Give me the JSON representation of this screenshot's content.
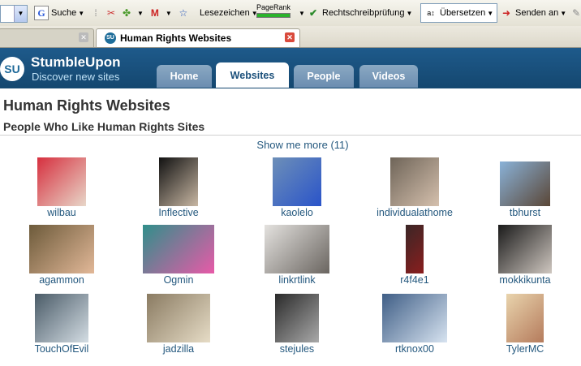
{
  "toolbar": {
    "search_label": "Suche",
    "bookmarks_label": "Lesezeichen",
    "pagerank_label": "PageRank",
    "spellcheck_label": "Rechtschreibprüfung",
    "translate_label": "Übersetzen",
    "send_label": "Senden an"
  },
  "browser_tabs": [
    {
      "label": "",
      "active": false
    },
    {
      "label": "Human Rights Websites",
      "active": true
    }
  ],
  "site": {
    "logo_mark": "SU",
    "name": "StumbleUpon",
    "tagline": "Discover new sites",
    "nav": [
      "Home",
      "Websites",
      "People",
      "Videos"
    ],
    "active_nav": "Websites"
  },
  "page": {
    "title": "Human Rights Websites",
    "subtitle": "People Who Like Human Rights Sites",
    "show_more": "Show me more (11)"
  },
  "people": [
    {
      "name": "wilbau",
      "colors": [
        "#d62f3e",
        "#e8d7c9"
      ]
    },
    {
      "name": "Inflective",
      "colors": [
        "#111111",
        "#c8b7a3"
      ]
    },
    {
      "name": "kaolelo",
      "colors": [
        "#6d8fb8",
        "#2a54c9"
      ]
    },
    {
      "name": "individualathome",
      "colors": [
        "#6e6458",
        "#d5c0ad"
      ]
    },
    {
      "name": "tbhurst",
      "colors": [
        "#8ab2d8",
        "#5a4636"
      ]
    },
    {
      "name": "agammon",
      "colors": [
        "#6c5a3a",
        "#e2b898"
      ]
    },
    {
      "name": "Ogmin",
      "colors": [
        "#2f8f8a",
        "#e85aa8"
      ]
    },
    {
      "name": "linkrtlink",
      "colors": [
        "#e4e2df",
        "#6a6560"
      ]
    },
    {
      "name": "r4f4e1",
      "colors": [
        "#3a2626",
        "#8a1e1e"
      ]
    },
    {
      "name": "mokkikunta",
      "colors": [
        "#1a1a1a",
        "#cfc7c0"
      ]
    },
    {
      "name": "TouchOfEvil",
      "colors": [
        "#4a5b67",
        "#d4dde4"
      ]
    },
    {
      "name": "jadzilla",
      "colors": [
        "#8a7b62",
        "#e6dcc6"
      ]
    },
    {
      "name": "stejules",
      "colors": [
        "#2a2a2a",
        "#a9a9a9"
      ]
    },
    {
      "name": "rtknox00",
      "colors": [
        "#3f5e86",
        "#d7e3f0"
      ]
    },
    {
      "name": "TylerMC",
      "colors": [
        "#e9d4ad",
        "#b57b5c"
      ]
    }
  ]
}
